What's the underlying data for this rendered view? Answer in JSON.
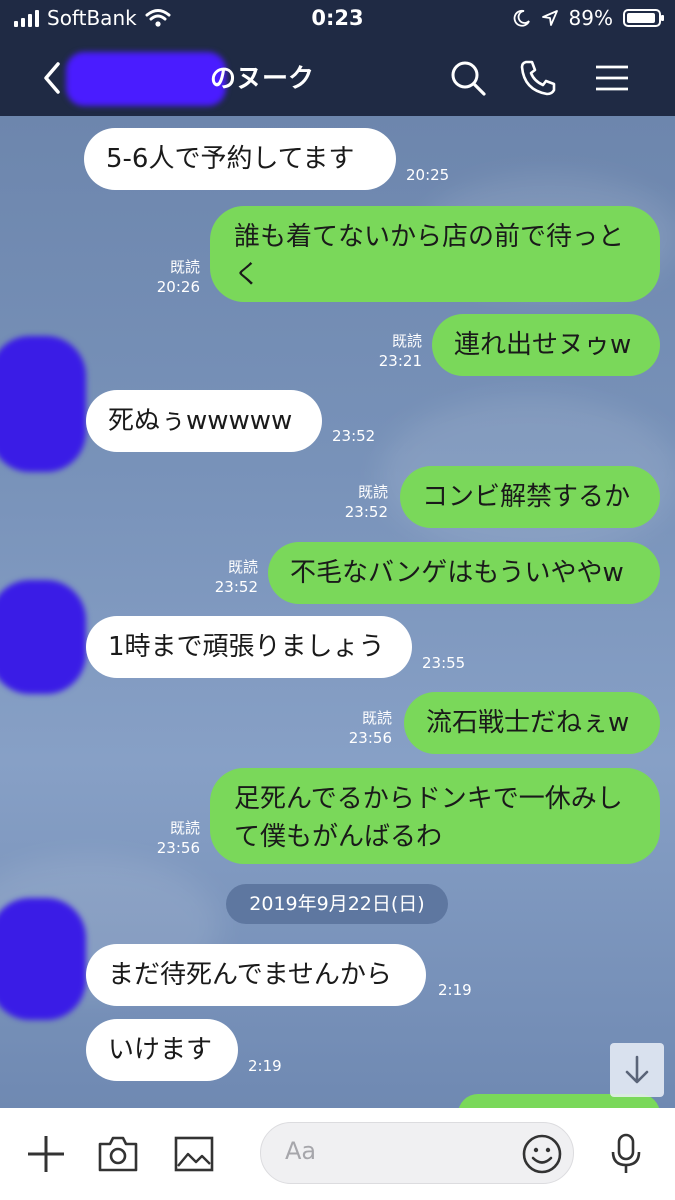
{
  "status": {
    "carrier": "SoftBank",
    "time": "0:23",
    "battery": "89%",
    "battery_level": 0.89
  },
  "header": {
    "title_suffix": "のヌーク"
  },
  "messages": [
    {
      "text": "5-6人で予約してます",
      "time": "20:25"
    },
    {
      "text": "誰も着てないから店の前で待っとく",
      "read": "既読",
      "time": "20:26"
    },
    {
      "text": "連れ出せヌゥw",
      "read": "既読",
      "time": "23:21"
    },
    {
      "text": "死ぬぅwwwww",
      "time": "23:52"
    },
    {
      "text": "コンビ解禁するか",
      "read": "既読",
      "time": "23:52"
    },
    {
      "text": "不毛なバンゲはもういややw",
      "read": "既読",
      "time": "23:52"
    },
    {
      "text": "1時まで頑張りましょう",
      "time": "23:55"
    },
    {
      "text": "流石戦士だねぇw",
      "read": "既読",
      "time": "23:56"
    },
    {
      "text": "足死んでるからドンキで一休みして僕もがんばるわ",
      "read": "既読",
      "time": "23:56"
    },
    {
      "text": "まだ待死んでませんから",
      "time": "2:19"
    },
    {
      "text": "いけます",
      "time": "2:19"
    }
  ],
  "date_separator": "2019年9月22日(日)",
  "composer": {
    "placeholder": "Aa"
  },
  "icons": [
    "back-icon",
    "search-icon",
    "phone-icon",
    "menu-icon",
    "scroll-down-icon",
    "plus-icon",
    "camera-icon",
    "image-icon",
    "emoji-icon",
    "mic-icon",
    "wifi-icon",
    "moon-icon",
    "location-icon"
  ],
  "colors": {
    "header": "#1f2a44",
    "outgoing_bubble": "#7ad85a",
    "incoming_bubble": "#ffffff",
    "chat_background": "#7a93b6"
  }
}
